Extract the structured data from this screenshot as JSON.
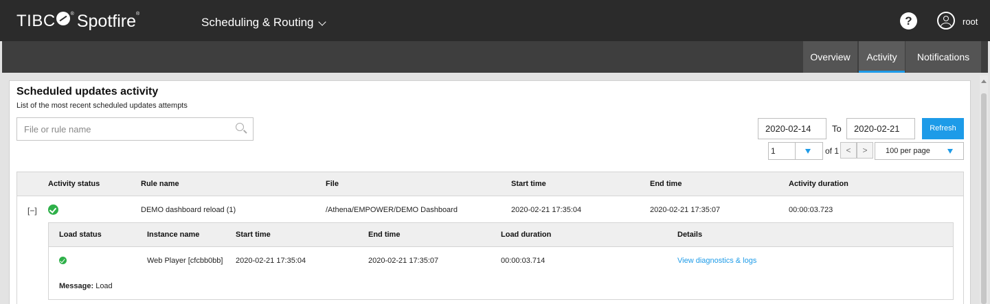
{
  "header": {
    "brand_left": "TIBC",
    "brand_reg": "®",
    "brand_right": "Spotfire",
    "brand_reg2": "®",
    "app_name": "Scheduling & Routing",
    "help_glyph": "?",
    "username": "root"
  },
  "tabs": [
    {
      "label": "Overview",
      "active": false
    },
    {
      "label": "Activity",
      "active": true
    },
    {
      "label": "Notifications",
      "active": false
    }
  ],
  "page": {
    "title": "Scheduled updates activity",
    "subtitle": "List of the most recent scheduled updates attempts"
  },
  "search": {
    "placeholder": "File or rule name",
    "value": ""
  },
  "date_range": {
    "from": "2020-02-14",
    "to_label": "To",
    "to": "2020-02-21",
    "refresh_label": "Refresh"
  },
  "pagination": {
    "page": "1",
    "of_label": "of 1",
    "prev": "<",
    "next": ">",
    "per_page": "100 per page"
  },
  "table": {
    "columns": [
      "Activity status",
      "Rule name",
      "File",
      "Start time",
      "End time",
      "Activity duration"
    ],
    "rows": [
      {
        "expander": "[−]",
        "status": "success",
        "rule_name": "DEMO dashboard reload (1)",
        "file": "/Athena/EMPOWER/DEMO Dashboard",
        "start_time": "2020-02-21 17:35:04",
        "end_time": "2020-02-21 17:35:07",
        "duration": "00:00:03.723",
        "details": {
          "columns": [
            "Load status",
            "Instance name",
            "Start time",
            "End time",
            "Load duration",
            "Details"
          ],
          "rows": [
            {
              "status": "success",
              "instance_name": "Web Player [cfcbb0bb]",
              "start_time": "2020-02-21 17:35:04",
              "end_time": "2020-02-21 17:35:07",
              "duration": "00:00:03.714",
              "details_link": "View diagnostics & logs"
            }
          ],
          "message_label": "Message:",
          "message": " Load"
        }
      }
    ]
  },
  "colors": {
    "topbar": "#2b2b2b",
    "subbar": "#3e3e3e",
    "accent": "#1d9be8",
    "success": "#2eb049"
  }
}
